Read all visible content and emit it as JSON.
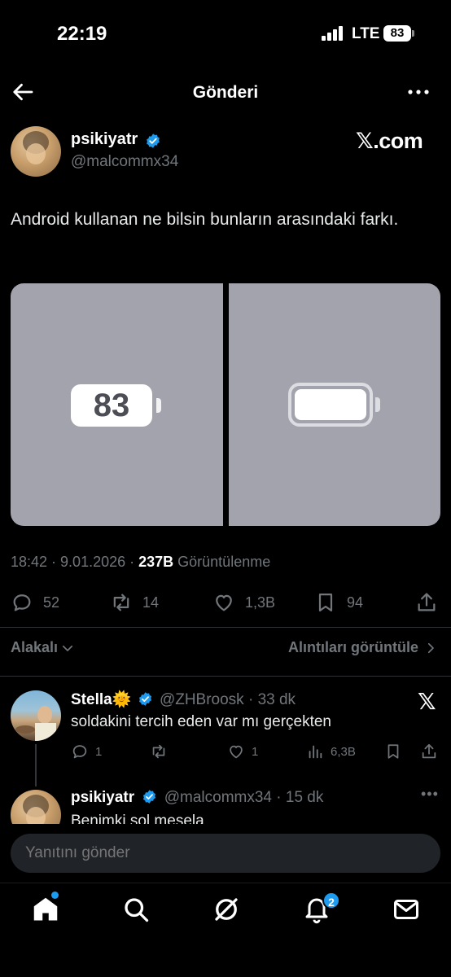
{
  "status_bar": {
    "time": "22:19",
    "network": "LTE",
    "battery": "83"
  },
  "nav": {
    "title": "Gönderi",
    "back_icon": "arrow-left-icon",
    "more_icon": "more-horizontal-icon"
  },
  "post": {
    "author_name": "psikiyatr",
    "author_handle": "@malcommx34",
    "source_logo": "𝕏.com",
    "text": "Android kullanan ne bilsin bunların arasındaki farkı.",
    "media": {
      "left_battery_label": "83"
    },
    "timestamp": "18:42 · 9.01.2026 · ",
    "views_count": "237B",
    "views_label": " Görüntülenme",
    "stats": {
      "replies": "52",
      "reposts": "14",
      "likes": "1,3B",
      "bookmarks": "94"
    }
  },
  "sort": {
    "label": "Alakalı",
    "quotes_label": "Alıntıları görüntüle"
  },
  "replies": [
    {
      "name": "Stella",
      "emoji": "🌞",
      "handle": "@ZHBroosk",
      "time": "· 33 dk",
      "text": "soldakini tercih eden var mı gerçekten",
      "stats": {
        "replies": "1",
        "likes": "1",
        "views": "6,3B"
      }
    },
    {
      "name": "psikiyatr",
      "handle": "@malcommx34",
      "time": "· 15 dk",
      "text": "Benimki sol mesela"
    }
  ],
  "composer": {
    "placeholder": "Yanıtını gönder"
  },
  "tabbar": {
    "notifications_badge": "2"
  },
  "colors": {
    "accent": "#1d9bf0",
    "muted": "#71767b",
    "background": "#000000",
    "media_bg": "#a2a3ad"
  }
}
